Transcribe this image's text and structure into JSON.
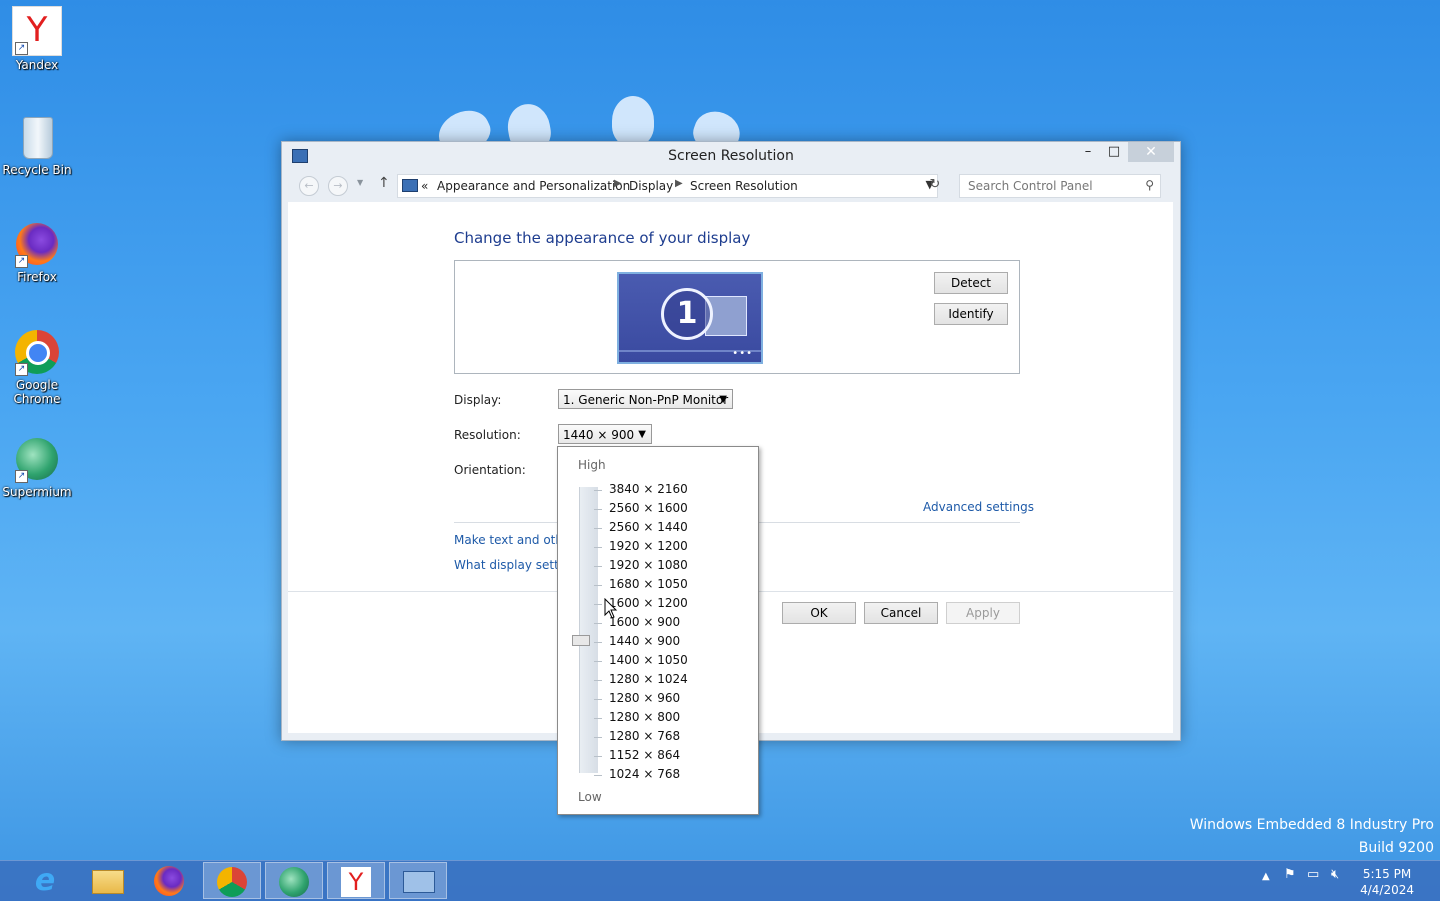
{
  "desktop": {
    "icons": [
      {
        "label": "Yandex"
      },
      {
        "label": "Recycle Bin"
      },
      {
        "label": "Firefox"
      },
      {
        "label": "Google Chrome"
      },
      {
        "label": "Supermium"
      }
    ],
    "watermark": {
      "line1": "Windows Embedded 8 Industry Pro",
      "line2": "Build 9200"
    }
  },
  "window": {
    "title": "Screen Resolution",
    "controls": {
      "minimize": "–",
      "maximize": "□",
      "close": "✕"
    },
    "address": {
      "overflow": "«",
      "crumbs": [
        "Appearance and Personalization",
        "Display",
        "Screen Resolution"
      ]
    },
    "search": {
      "placeholder": "Search Control Panel"
    },
    "heading": "Change the appearance of your display",
    "monitor_number": "1",
    "detect_label": "Detect",
    "identify_label": "Identify",
    "fields": {
      "display_label": "Display:",
      "display_value": "1. Generic Non-PnP Monitor",
      "resolution_label": "Resolution:",
      "resolution_value": "1440 × 900",
      "orientation_label": "Orientation:"
    },
    "advanced_link": "Advanced settings",
    "links": [
      "Make text and other",
      "What display setting"
    ],
    "buttons": {
      "ok": "OK",
      "cancel": "Cancel",
      "apply": "Apply"
    }
  },
  "resolution_dropdown": {
    "high_label": "High",
    "low_label": "Low",
    "options": [
      "3840 × 2160",
      "2560 × 1600",
      "2560 × 1440",
      "1920 × 1200",
      "1920 × 1080",
      "1680 × 1050",
      "1600 × 1200",
      "1600 × 900",
      "1440 × 900",
      "1400 × 1050",
      "1280 × 1024",
      "1280 × 960",
      "1280 × 800",
      "1280 × 768",
      "1152 × 864",
      "1024 × 768"
    ],
    "selected": "1440 × 900"
  },
  "taskbar": {
    "apps": [
      "internet-explorer",
      "file-explorer",
      "firefox",
      "chrome",
      "supermium",
      "yandex",
      "control-panel"
    ],
    "clock_time": "5:15 PM",
    "clock_date": "4/4/2024"
  }
}
